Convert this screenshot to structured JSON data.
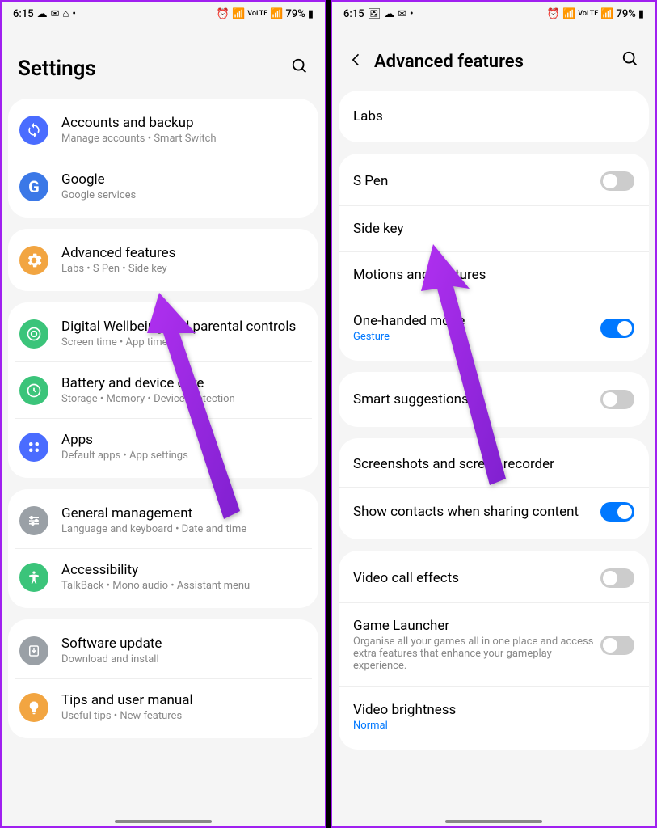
{
  "status": {
    "time": "6:15",
    "battery": "79%"
  },
  "left": {
    "title": "Settings",
    "groups": [
      [
        {
          "icon": "sync",
          "color": "#4a6cff",
          "title": "Accounts and backup",
          "subtitle": "Manage accounts  •  Smart Switch"
        },
        {
          "icon": "G",
          "color": "#3b78e7",
          "title": "Google",
          "subtitle": "Google services"
        }
      ],
      [
        {
          "icon": "gear",
          "color": "#f2a541",
          "title": "Advanced features",
          "subtitle": "Labs  •  S Pen  •  Side key"
        }
      ],
      [
        {
          "icon": "wellbeing",
          "color": "#3bc47a",
          "title": "Digital Wellbeing and parental controls",
          "subtitle": "Screen time  •  App timers"
        },
        {
          "icon": "battery",
          "color": "#3bc47a",
          "title": "Battery and device care",
          "subtitle": "Storage  •  Memory  •  Device protection"
        },
        {
          "icon": "apps",
          "color": "#4a6cff",
          "title": "Apps",
          "subtitle": "Default apps  •  App settings"
        }
      ],
      [
        {
          "icon": "sliders",
          "color": "#9aa0a6",
          "title": "General management",
          "subtitle": "Language and keyboard  •  Date and time"
        },
        {
          "icon": "a11y",
          "color": "#3bc47a",
          "title": "Accessibility",
          "subtitle": "TalkBack  •  Mono audio  •  Assistant menu"
        }
      ],
      [
        {
          "icon": "update",
          "color": "#9aa0a6",
          "title": "Software update",
          "subtitle": "Download and install"
        },
        {
          "icon": "tips",
          "color": "#f2a541",
          "title": "Tips and user manual",
          "subtitle": "Useful tips  •  New features"
        }
      ]
    ]
  },
  "right": {
    "title": "Advanced features",
    "groups": [
      [
        {
          "title": "Labs"
        }
      ],
      [
        {
          "title": "S Pen",
          "toggle": false
        },
        {
          "title": "Side key"
        },
        {
          "title": "Motions and gestures"
        },
        {
          "title": "One-handed mode",
          "subtitleBlue": "Gesture",
          "toggle": true
        }
      ],
      [
        {
          "title": "Smart suggestions",
          "toggle": false
        }
      ],
      [
        {
          "title": "Screenshots and screen recorder"
        },
        {
          "title": "Show contacts when sharing content",
          "toggle": true
        }
      ],
      [
        {
          "title": "Video call effects",
          "toggle": false
        },
        {
          "title": "Game Launcher",
          "subtitle": "Organise all your games all in one place and access extra features that enhance your gameplay experience.",
          "toggle": false
        },
        {
          "title": "Video brightness",
          "subtitleBlue": "Normal"
        }
      ]
    ]
  }
}
